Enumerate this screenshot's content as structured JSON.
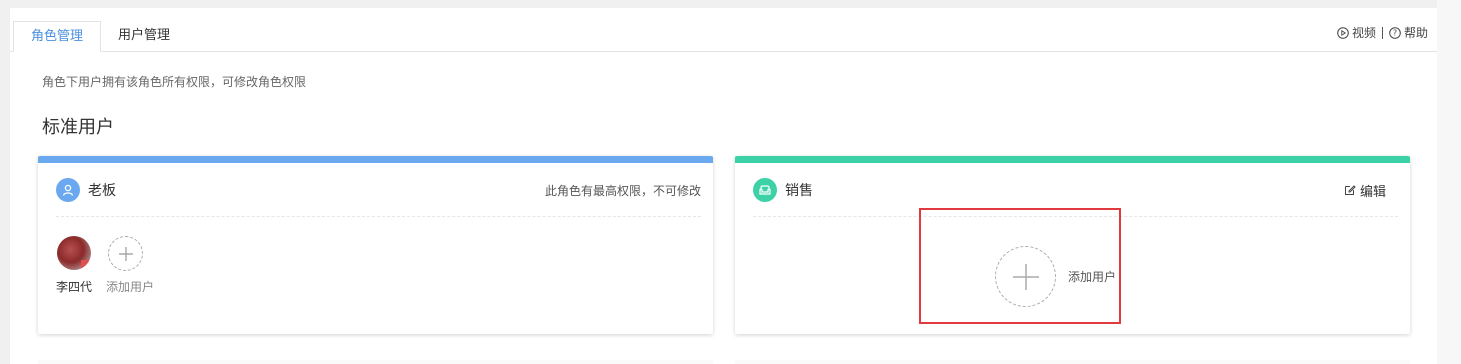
{
  "tabs": [
    {
      "label": "角色管理",
      "active": true
    },
    {
      "label": "用户管理",
      "active": false
    }
  ],
  "help": {
    "video_label": "视频",
    "help_label": "帮助"
  },
  "description": "角色下用户拥有该角色所有权限，可修改角色权限",
  "section_title": "标准用户",
  "cards": [
    {
      "role_name": "老板",
      "accent_color": "#6aa8f0",
      "icon": "user-icon",
      "icon_bg": "#6aa8f0",
      "note": "此角色有最高权限，不可修改",
      "members": [
        {
          "name": "李四代"
        }
      ],
      "add_label": "添加用户"
    },
    {
      "role_name": "销售",
      "accent_color": "#3dd1a8",
      "icon": "sofa-icon",
      "icon_bg": "#3dd1a8",
      "edit_label": "编辑",
      "add_label": "添加用户"
    }
  ],
  "colors": {
    "active_tab": "#4a90e2",
    "highlight": "#e0393e"
  }
}
